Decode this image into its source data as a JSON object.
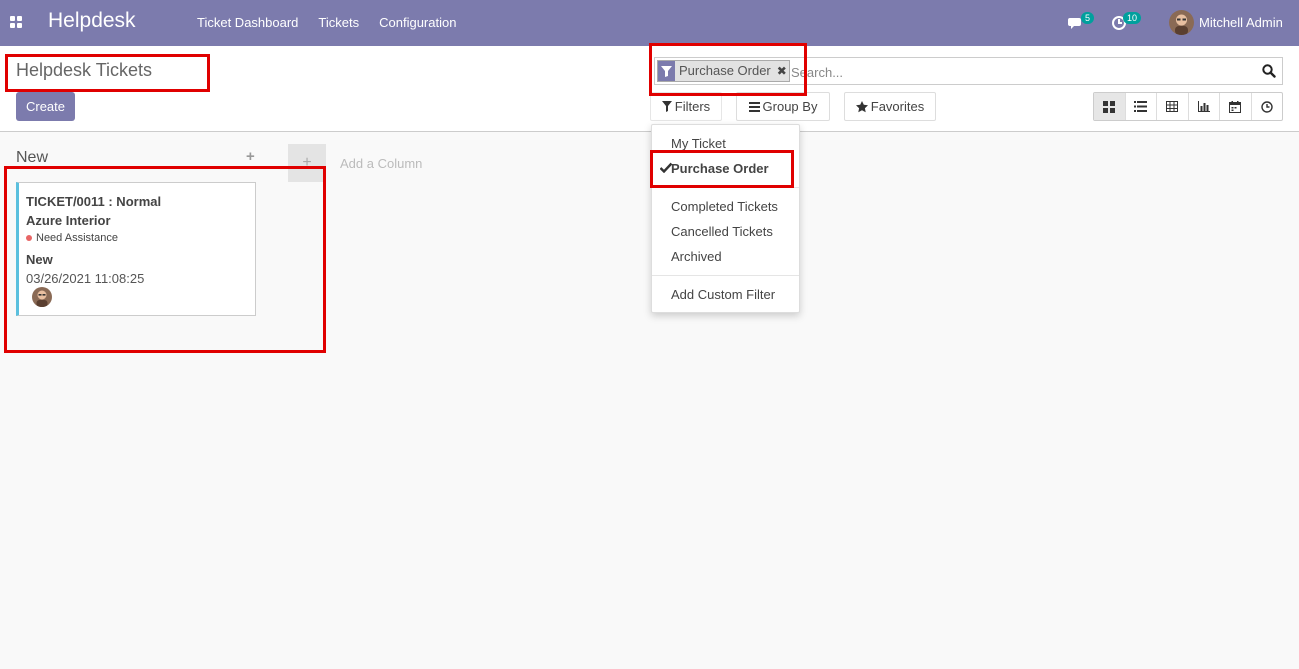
{
  "navbar": {
    "brand": "Helpdesk",
    "menu": [
      "Ticket Dashboard",
      "Tickets",
      "Configuration"
    ],
    "messages_count": "5",
    "activities_count": "10",
    "user_name": "Mitchell Admin"
  },
  "control_panel": {
    "title": "Helpdesk Tickets",
    "create_label": "Create",
    "search": {
      "facet_label": "Purchase Order",
      "placeholder": "Search..."
    },
    "filters_label": "Filters",
    "group_by_label": "Group By",
    "favorites_label": "Favorites",
    "views": [
      "kanban",
      "list",
      "pivot",
      "graph",
      "calendar",
      "activity"
    ]
  },
  "filters_dropdown": {
    "items": [
      {
        "label": "My Ticket",
        "checked": false
      },
      {
        "label": "Purchase Order",
        "checked": true
      },
      {
        "label": "Completed Tickets",
        "checked": false
      },
      {
        "label": "Cancelled Tickets",
        "checked": false
      },
      {
        "label": "Archived",
        "checked": false
      }
    ],
    "custom_filter_label": "Add Custom Filter"
  },
  "kanban": {
    "column_title": "New",
    "add_column_label": "Add a Column",
    "card": {
      "ticket": "TICKET/0011 : Normal",
      "customer": "Azure Interior",
      "tag": "Need Assistance",
      "stage": "New",
      "date": "03/26/2021 11:08:25"
    }
  },
  "colors": {
    "brand": "#7c7bad",
    "badge": "#00a09d",
    "card_border": "#5bc0de",
    "highlight": "#e00000"
  }
}
